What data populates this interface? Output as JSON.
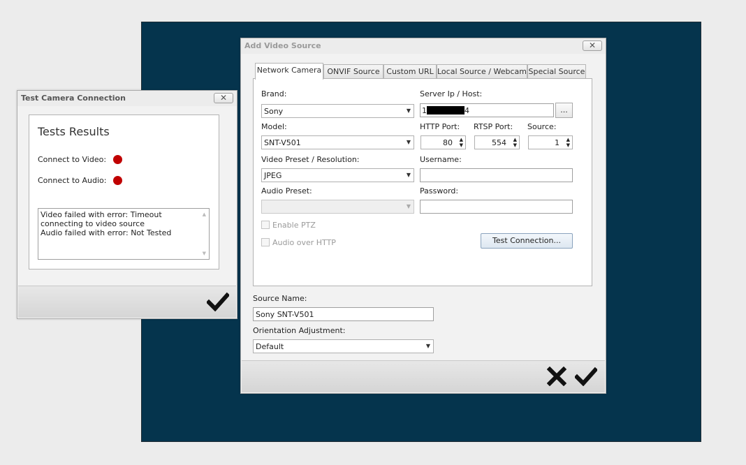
{
  "colors": {
    "desktop_background": "#05344d",
    "status_failed": "#c00000",
    "accent_button": "#dde7f1"
  },
  "main_dialog": {
    "title": "Add Video Source",
    "close_icon": "close-icon",
    "tabs": [
      {
        "label": "Network Camera",
        "active": true
      },
      {
        "label": "ONVIF Source",
        "active": false
      },
      {
        "label": "Custom URL",
        "active": false
      },
      {
        "label": "Local Source / Webcam",
        "active": false
      },
      {
        "label": "Special Source",
        "active": false
      }
    ],
    "brand": {
      "label": "Brand:",
      "value": "Sony"
    },
    "model": {
      "label": "Model:",
      "value": "SNT-V501"
    },
    "video_preset": {
      "label": "Video Preset / Resolution:",
      "value": "JPEG"
    },
    "audio_preset": {
      "label": "Audio Preset:",
      "value": ""
    },
    "server": {
      "label": "Server Ip / Host:",
      "value_start": "1",
      "value_end": "4",
      "browse_label": "..."
    },
    "http_port": {
      "label": "HTTP Port:",
      "value": "80"
    },
    "rtsp_port": {
      "label": "RTSP Port:",
      "value": "554"
    },
    "source": {
      "label": "Source:",
      "value": "1"
    },
    "username": {
      "label": "Username:",
      "value": ""
    },
    "password": {
      "label": "Password:",
      "value": ""
    },
    "enable_ptz": {
      "label": "Enable PTZ",
      "checked": false
    },
    "audio_over_http": {
      "label": "Audio over HTTP",
      "checked": false
    },
    "test_connection_label": "Test Connection...",
    "source_name": {
      "label": "Source Name:",
      "value": "Sony SNT-V501"
    },
    "orientation": {
      "label": "Orientation Adjustment:",
      "value": "Default"
    },
    "footer": {
      "cancel_icon": "x-cancel-icon",
      "ok_icon": "checkmark-icon"
    }
  },
  "test_dialog": {
    "title": "Test Camera Connection",
    "close_icon": "close-icon",
    "results_title": "Tests Results",
    "tests": [
      {
        "label": "Connect to Video:",
        "status": "failed"
      },
      {
        "label": "Connect to Audio:",
        "status": "failed"
      }
    ],
    "log_lines": [
      "Video failed with error: Timeout connecting to video source",
      "Audio failed with error: Not Tested"
    ],
    "footer": {
      "ok_icon": "checkmark-icon"
    }
  }
}
